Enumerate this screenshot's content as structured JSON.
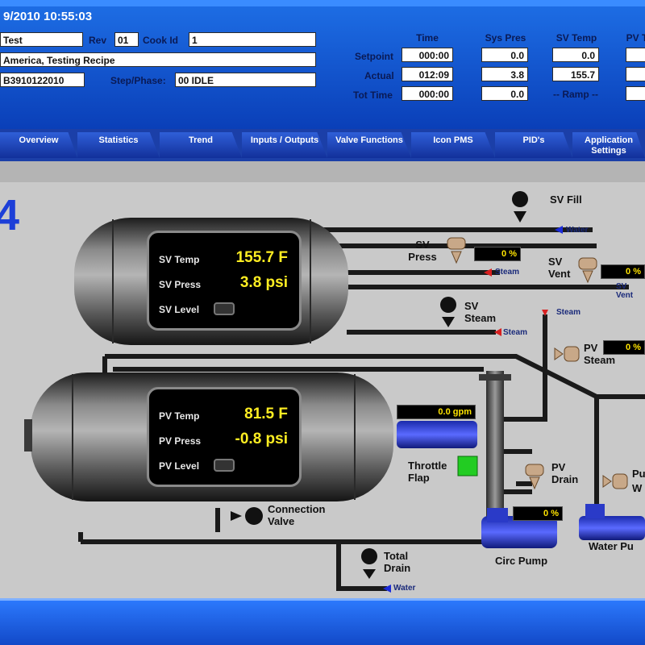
{
  "header": {
    "datetime": "9/2010 10:55:03",
    "recipe_label": "Test",
    "rev_label": "Rev",
    "rev_value": "01",
    "cook_id_label": "Cook Id",
    "cook_id_value": "1",
    "recipe_name": "America, Testing Recipe",
    "batch_value": "B3910122010",
    "step_phase_label": "Step/Phase:",
    "step_phase_value": "00 IDLE",
    "columns": [
      "Time",
      "Sys Pres",
      "SV Temp",
      "PV T"
    ],
    "rows": [
      {
        "label": "Setpoint",
        "values": [
          "000:00",
          "0.0",
          "0.0",
          ""
        ]
      },
      {
        "label": "Actual",
        "values": [
          "012:09",
          "3.8",
          "155.7",
          ""
        ]
      },
      {
        "label": "Tot Time",
        "values": [
          "000:00",
          "0.0",
          "",
          ""
        ]
      }
    ],
    "ramp_text": "-- Ramp --"
  },
  "tabs": [
    {
      "label": "Overview"
    },
    {
      "label": "Statistics"
    },
    {
      "label": "Trend"
    },
    {
      "label": "Inputs / Outputs"
    },
    {
      "label": "Valve Functions"
    },
    {
      "label": "Icon PMS"
    },
    {
      "label": "PID's"
    },
    {
      "label": "Application Settings"
    }
  ],
  "process": {
    "unit_number": "4",
    "sv_panel": {
      "temp_label": "SV Temp",
      "temp_value": "155.7 F",
      "press_label": "SV Press",
      "press_value": "3.8 psi",
      "level_label": "SV Level"
    },
    "pv_panel": {
      "temp_label": "PV Temp",
      "temp_value": "81.5 F",
      "press_label": "PV Press",
      "press_value": "-0.8 psi",
      "level_label": "PV Level"
    },
    "valves": {
      "sv_fill": "SV Fill",
      "sv_press": "SV Press",
      "sv_vent": "SV Vent",
      "sv_steam": "SV Steam",
      "pv_steam": "PV Steam",
      "pv_drain": "PV Drain",
      "throttle_flap": "Throttle Flap",
      "connection_valve": "Connection Valve",
      "total_drain": "Total Drain",
      "circ_pump": "Circ Pump",
      "water_pump": "Water Pu",
      "pu_partial": "Pu",
      "w_partial": "W"
    },
    "readouts": {
      "sv_press_pct": "0 %",
      "sv_vent_pct": "0 %",
      "pv_steam_pct": "0 %",
      "flow": "0.0 gpm",
      "pv_drain_pct": "0 %"
    },
    "tags": {
      "water": "Water",
      "steam": "Steam",
      "sv_vent_tag": "SV Vent"
    }
  }
}
